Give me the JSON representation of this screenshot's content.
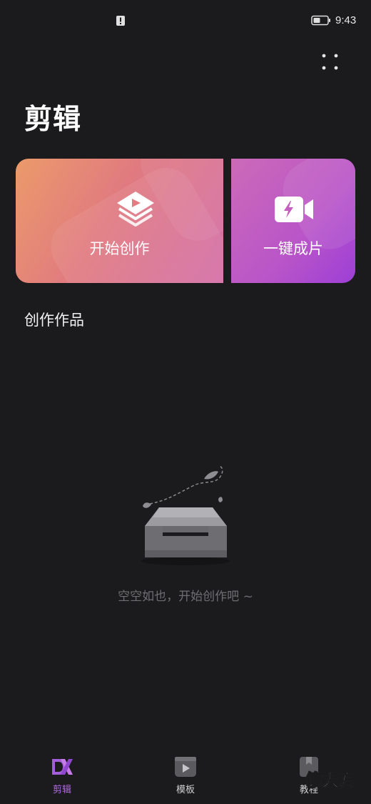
{
  "status_bar": {
    "time": "9:43",
    "alert_icon": "alert-icon",
    "battery_icon": "battery-icon"
  },
  "header": {
    "title": "剪辑",
    "more_icon": "more-dots-icon"
  },
  "actions": {
    "start_label": "开始创作",
    "quick_label": "一键成片"
  },
  "works": {
    "section_title": "创作作品",
    "empty_text": "空空如也，开始创作吧 ~"
  },
  "bottom_nav": {
    "items": [
      {
        "label": "剪辑",
        "icon": "edit-icon",
        "active": true
      },
      {
        "label": "模板",
        "icon": "template-icon",
        "active": false
      },
      {
        "label": "教程",
        "icon": "tutorial-icon",
        "active": false
      }
    ]
  },
  "watermark": {
    "first_char": "傻",
    "rest": "大方"
  },
  "colors": {
    "background": "#1b1b1d",
    "active_tab": "#b06ae0",
    "card_start_gradient": [
      "#ec9a6a",
      "#d46ea8"
    ],
    "card_quick_gradient": [
      "#cc6ab8",
      "#9d3fd6"
    ]
  }
}
